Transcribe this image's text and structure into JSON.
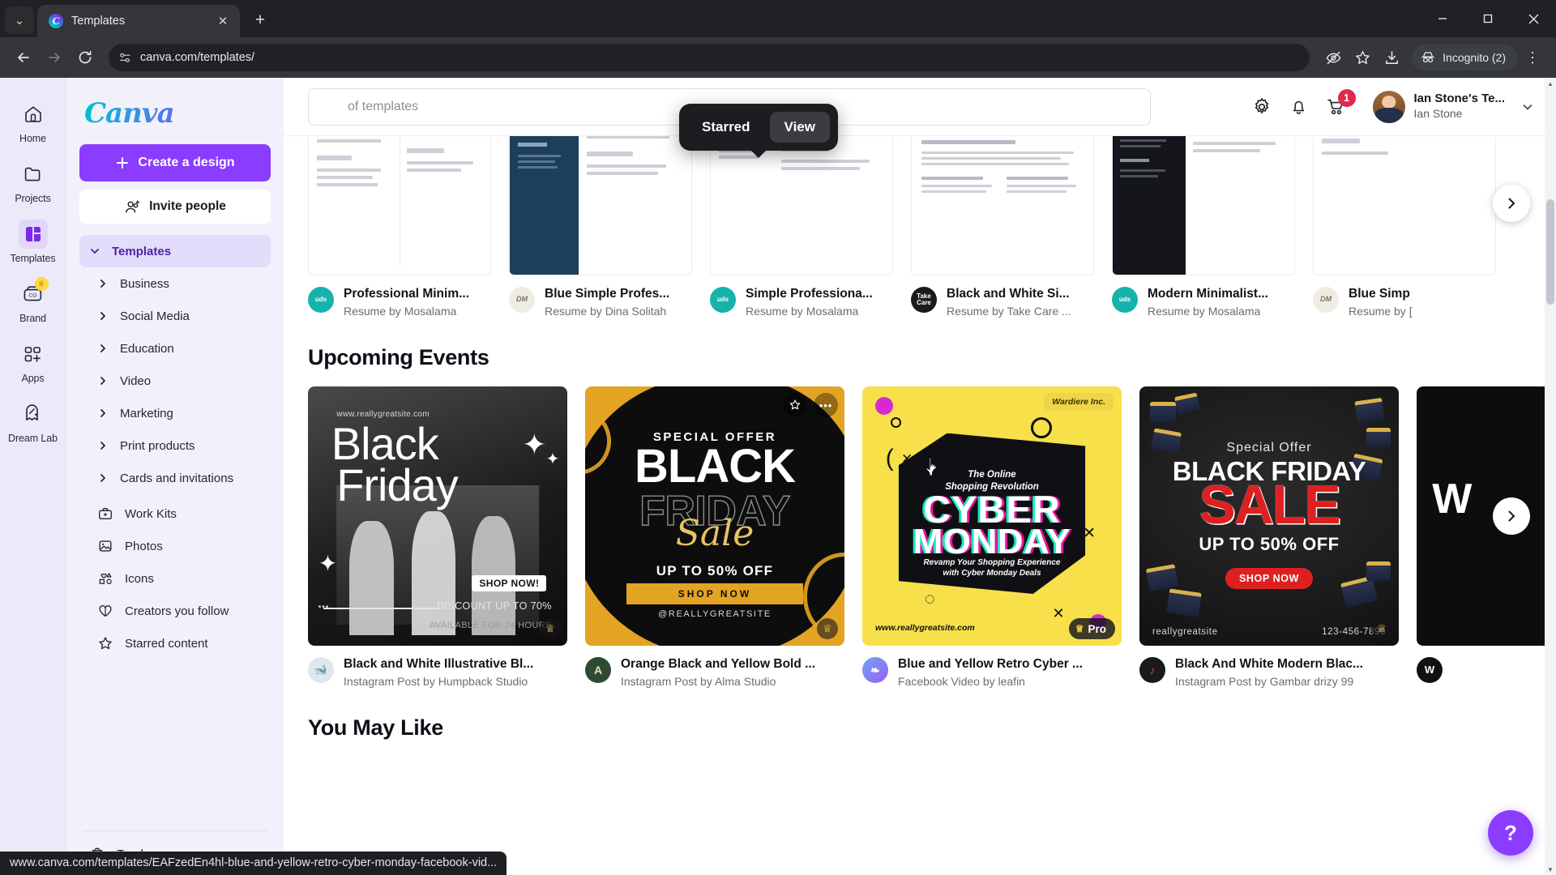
{
  "browser": {
    "tab": {
      "title": "Templates",
      "favicon": "canva-logo-icon",
      "close": "✕"
    },
    "new_tab_label": "+",
    "tab_list_chevron": "⌄",
    "window_controls": {
      "minimize": "—",
      "maximize": "▢",
      "close": "✕"
    },
    "nav": {
      "back": "←",
      "forward": "→",
      "reload": "⟳"
    },
    "url": "canva.com/templates/",
    "site_info_icon": "page-settings-icon",
    "toolbar_icons": {
      "eye_off": "hide-password-icon",
      "bookmark": "star-icon",
      "download": "download-icon",
      "menu": "⋮"
    },
    "profile_pill": {
      "label": "Incognito (2)",
      "icon": "incognito-icon"
    },
    "status_text": "www.canva.com/templates/EAFzedEn4hl-blue-and-yellow-retro-cyber-monday-facebook-vid..."
  },
  "rail": {
    "items": [
      {
        "label": "Home",
        "icon": "home-icon",
        "active": false,
        "badge": ""
      },
      {
        "label": "Projects",
        "icon": "folder-icon",
        "active": false,
        "badge": ""
      },
      {
        "label": "Templates",
        "icon": "templates-grid-icon",
        "active": true,
        "badge": ""
      },
      {
        "label": "Brand",
        "icon": "brand-co-icon",
        "active": false,
        "badge": "crown"
      },
      {
        "label": "Apps",
        "icon": "apps-grid-plus-icon",
        "active": false,
        "badge": ""
      },
      {
        "label": "Dream Lab",
        "icon": "dream-lab-icon",
        "active": false,
        "badge": ""
      }
    ]
  },
  "sidebar": {
    "logo": "Canva",
    "create_button": {
      "label": "Create a design",
      "icon": "plus-icon"
    },
    "invite_button": {
      "label": "Invite people",
      "icon": "people-add-icon"
    },
    "templates_row": {
      "label": "Templates",
      "icon": "chevron-down-icon"
    },
    "categories": [
      {
        "label": "Business",
        "icon": "chevron-right-icon"
      },
      {
        "label": "Social Media",
        "icon": "chevron-right-icon"
      },
      {
        "label": "Education",
        "icon": "chevron-right-icon"
      },
      {
        "label": "Video",
        "icon": "chevron-right-icon"
      },
      {
        "label": "Marketing",
        "icon": "chevron-right-icon"
      },
      {
        "label": "Print products",
        "icon": "chevron-right-icon"
      },
      {
        "label": "Cards and invitations",
        "icon": "chevron-right-icon"
      }
    ],
    "links": [
      {
        "label": "Work Kits",
        "icon": "briefcase-icon"
      },
      {
        "label": "Photos",
        "icon": "image-icon"
      },
      {
        "label": "Icons",
        "icon": "shapes-icon"
      },
      {
        "label": "Creators you follow",
        "icon": "heart-folder-icon"
      },
      {
        "label": "Starred content",
        "icon": "star-outline-icon"
      }
    ],
    "trash": {
      "label": "Trash",
      "icon": "trash-icon"
    }
  },
  "topbar": {
    "search_placeholder": "of templates",
    "search_value": "",
    "icons": {
      "settings": "gear-icon",
      "notifications": "bell-icon",
      "cart": "shopping-cart-icon",
      "cart_count": "1",
      "account_chevron": "chevron-down-icon"
    },
    "user": {
      "team": "Ian Stone's Te...",
      "name": "Ian Stone"
    }
  },
  "tooltip": {
    "items": [
      {
        "label": "Starred",
        "active": false
      },
      {
        "label": "View",
        "active": true
      }
    ]
  },
  "resume_row": {
    "cards": [
      {
        "title": "Professional Minim...",
        "subtitle": "Resume by Mosalama",
        "avatar": "uds-badge",
        "avatar_text": "uds",
        "avatar_bg": "#16b3ad"
      },
      {
        "title": "Blue Simple Profes...",
        "subtitle": "Resume by Dina Solitah",
        "avatar": "dm-monogram",
        "avatar_text": "DM",
        "avatar_bg": "#efece4"
      },
      {
        "title": "Simple Professiona...",
        "subtitle": "Resume by Mosalama",
        "avatar": "uds-badge",
        "avatar_text": "uds",
        "avatar_bg": "#16b3ad"
      },
      {
        "title": "Black and White Si...",
        "subtitle": "Resume by Take Care ...",
        "avatar": "take-care-badge",
        "avatar_text": "Take Care",
        "avatar_bg": "#1b1b1b"
      },
      {
        "title": "Modern Minimalist...",
        "subtitle": "Resume by Mosalama",
        "avatar": "uds-badge",
        "avatar_text": "uds",
        "avatar_bg": "#16b3ad"
      },
      {
        "title": "Blue Simp",
        "subtitle": "Resume by [",
        "avatar": "dm-monogram",
        "avatar_text": "DM",
        "avatar_bg": "#efece4"
      }
    ],
    "next_arrow": "chevron-right-icon"
  },
  "events_section": {
    "title": "Upcoming Events",
    "next_arrow": "chevron-right-icon",
    "cards": [
      {
        "title": "Black and White Illustrative Bl...",
        "subtitle": "Instagram Post by Humpback Studio",
        "avatar_bg": "#dfe7ec",
        "badge": "crown",
        "art": {
          "kind": "bw-blackfriday",
          "website": "www.reallygreatsite.com",
          "headline1": "Black",
          "headline2": "Friday",
          "cta": "SHOP NOW!",
          "line1": "DISCOUNT UP TO 70%",
          "line2": "AVAILABLE FOR 24 HOURS"
        }
      },
      {
        "title": "Orange Black and Yellow Bold ...",
        "subtitle": "Instagram Post by Alma Studio",
        "avatar_bg": "#2e4a33",
        "badge": "crown",
        "hover": true,
        "art": {
          "kind": "orange-blackfriday",
          "eyebrow": "SPECIAL OFFER",
          "headline1": "BLACK",
          "headline2": "FRIDAY",
          "script": "Sale",
          "offer": "UP TO 50% OFF",
          "cta": "SHOP NOW",
          "handle": "@REALLYGREATSITE"
        }
      },
      {
        "title": "Blue and Yellow Retro Cyber ...",
        "subtitle": "Facebook Video by leafin",
        "avatar_bg": "#7d5cf6",
        "badge": "Pro",
        "art": {
          "kind": "cyber-monday",
          "brand": "Wardiere Inc.",
          "eyebrow1": "The Online",
          "eyebrow2": "Shopping Revolution",
          "headline1": "CYBER",
          "headline2": "MONDAY",
          "sub1": "Revamp Your Shopping Experience",
          "sub2": "with Cyber Monday Deals",
          "website": "www.reallygreatsite.com"
        }
      },
      {
        "title": "Black And White Modern Blac...",
        "subtitle": "Instagram Post by Gambar drizy 99",
        "avatar_bg": "#1a1a1a",
        "badge": "crown",
        "art": {
          "kind": "gift-blackfriday",
          "eyebrow": "Special Offer",
          "headline1": "BLACK FRIDAY",
          "headline2": "SALE",
          "offer": "UP TO 50% OFF",
          "cta": "SHOP NOW",
          "handle": "reallygreatsite",
          "phone": "123-456-7890"
        }
      },
      {
        "title": "",
        "subtitle": "",
        "avatar_bg": "#111111",
        "badge": "crown",
        "art": {
          "kind": "purple-partial"
        }
      }
    ]
  },
  "next_section": {
    "title": "You May Like"
  },
  "help_fab": {
    "label": "?"
  },
  "colors": {
    "canva_purple": "#8b3dff",
    "sidebar_bg": "#f2f1fb",
    "rail_bg": "#eceaf8",
    "accent_selected": "#e3dcfa",
    "badge_red": "#e02a4b",
    "tooltip_bg": "#1d1d21"
  }
}
